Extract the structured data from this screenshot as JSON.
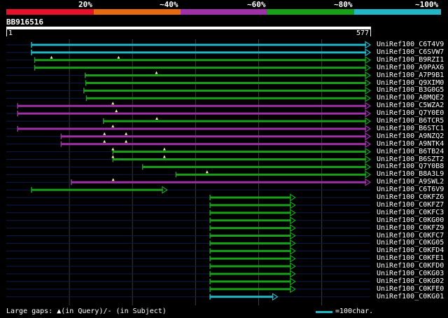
{
  "colors": {
    "red": "#e8102a",
    "orange": "#e86a10",
    "purple": "#a030a8",
    "green": "#18a018",
    "cyan": "#20b8c8",
    "guide": "#0e1a4a",
    "grid": "#3a3a3a",
    "gap_mark": "#f0f0a0"
  },
  "scale": {
    "labels": [
      "20%",
      "~40%",
      "~60%",
      "~80%",
      "~100%"
    ]
  },
  "query": {
    "id": "BB916516",
    "start": "1",
    "end": "577",
    "length": 577
  },
  "hits": [
    {
      "label": "UniRef100_C6T4V9",
      "color": "cyan",
      "start": 40,
      "end": 577,
      "gaps": []
    },
    {
      "label": "UniRef100_C6SVW7",
      "color": "cyan",
      "start": 40,
      "end": 577,
      "gaps": []
    },
    {
      "label": "UniRef100_B9RZI1",
      "color": "green",
      "start": 45,
      "end": 577,
      "gaps": [
        0.05,
        0.25
      ]
    },
    {
      "label": "UniRef100_A9PAX6",
      "color": "green",
      "start": 45,
      "end": 577,
      "gaps": []
    },
    {
      "label": "UniRef100_A7P9B1",
      "color": "green",
      "start": 125,
      "end": 577,
      "gaps": [
        0.25
      ]
    },
    {
      "label": "UniRef100_Q9XIM0",
      "color": "green",
      "start": 126,
      "end": 577,
      "gaps": []
    },
    {
      "label": "UniRef100_B3G0G5",
      "color": "green",
      "start": 123,
      "end": 577,
      "gaps": []
    },
    {
      "label": "UniRef100_A8MQE2",
      "color": "green",
      "start": 127,
      "end": 577,
      "gaps": []
    },
    {
      "label": "UniRef100_C5WZA2",
      "color": "purple",
      "start": 18,
      "end": 577,
      "gaps": [
        0.27
      ]
    },
    {
      "label": "UniRef100_Q7Y0E0",
      "color": "purple",
      "start": 18,
      "end": 577,
      "gaps": [
        0.28
      ]
    },
    {
      "label": "UniRef100_B6TCR5",
      "color": "green",
      "start": 154,
      "end": 577,
      "gaps": [
        0.2
      ]
    },
    {
      "label": "UniRef100_B6STC1",
      "color": "purple",
      "start": 18,
      "end": 577,
      "gaps": [
        0.27
      ]
    },
    {
      "label": "UniRef100_A9NZQ2",
      "color": "purple",
      "start": 87,
      "end": 577,
      "gaps": [
        0.14,
        0.21
      ]
    },
    {
      "label": "UniRef100_A9NTK4",
      "color": "purple",
      "start": 87,
      "end": 577,
      "gaps": [
        0.14,
        0.21
      ]
    },
    {
      "label": "UniRef100_B6TB24",
      "color": "green",
      "start": 169,
      "end": 577,
      "gaps": [
        0.0,
        0.2
      ]
    },
    {
      "label": "UniRef100_B6SZT2",
      "color": "green",
      "start": 169,
      "end": 577,
      "gaps": [
        0.0,
        0.2
      ]
    },
    {
      "label": "UniRef100_Q7Y0B8",
      "color": "green",
      "start": 216,
      "end": 577,
      "gaps": []
    },
    {
      "label": "UniRef100_B8A3L9",
      "color": "green",
      "start": 269,
      "end": 577,
      "gaps": [
        0.16
      ]
    },
    {
      "label": "UniRef100_A9SWL2",
      "color": "purple",
      "start": 103,
      "end": 577,
      "gaps": [
        0.14
      ]
    },
    {
      "label": "UniRef100_C6T6V9",
      "color": "green",
      "start": 40,
      "end": 255,
      "gaps": []
    },
    {
      "label": "UniRef100_C0KFZ6",
      "color": "green",
      "start": 323,
      "end": 458,
      "gaps": []
    },
    {
      "label": "UniRef100_C0KFZ7",
      "color": "green",
      "start": 323,
      "end": 458,
      "gaps": []
    },
    {
      "label": "UniRef100_C0KFC3",
      "color": "green",
      "start": 323,
      "end": 458,
      "gaps": []
    },
    {
      "label": "UniRef100_C0KG00",
      "color": "green",
      "start": 323,
      "end": 458,
      "gaps": []
    },
    {
      "label": "UniRef100_C0KFZ9",
      "color": "green",
      "start": 323,
      "end": 458,
      "gaps": []
    },
    {
      "label": "UniRef100_C0KFC7",
      "color": "green",
      "start": 323,
      "end": 458,
      "gaps": []
    },
    {
      "label": "UniRef100_C0KG05",
      "color": "green",
      "start": 323,
      "end": 458,
      "gaps": []
    },
    {
      "label": "UniRef100_C0KFD4",
      "color": "green",
      "start": 323,
      "end": 458,
      "gaps": []
    },
    {
      "label": "UniRef100_C0KFE1",
      "color": "green",
      "start": 323,
      "end": 458,
      "gaps": []
    },
    {
      "label": "UniRef100_C0KFD0",
      "color": "green",
      "start": 323,
      "end": 458,
      "gaps": []
    },
    {
      "label": "UniRef100_C0KG03",
      "color": "green",
      "start": 323,
      "end": 458,
      "gaps": []
    },
    {
      "label": "UniRef100_C0KG02",
      "color": "green",
      "start": 323,
      "end": 458,
      "gaps": []
    },
    {
      "label": "UniRef100_C0KFE0",
      "color": "green",
      "start": 323,
      "end": 458,
      "gaps": []
    },
    {
      "label": "UniRef100_C0KG01",
      "color": "cyan",
      "start": 323,
      "end": 430,
      "gaps": []
    }
  ],
  "footer": {
    "text": "Large gaps: ▲(in Query)/- (in Subject)",
    "legend": "=100char."
  }
}
